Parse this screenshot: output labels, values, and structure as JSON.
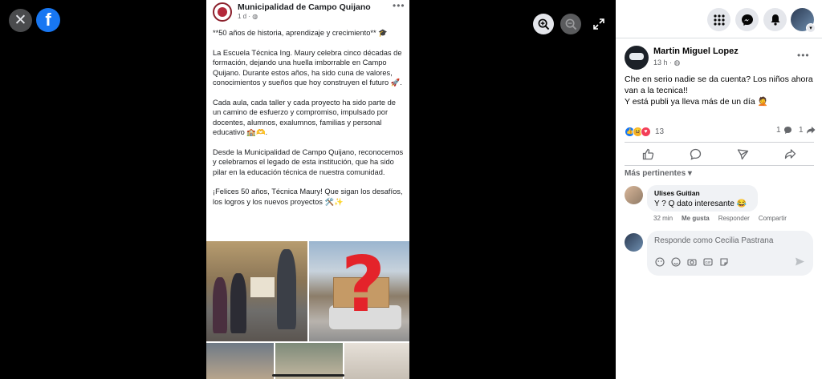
{
  "viewer": {
    "close_icon": "close-icon",
    "logo_icon": "facebook-logo-icon",
    "logo_text": "f",
    "zoom_in_icon": "zoom-in-icon",
    "zoom_out_icon": "zoom-out-icon",
    "expand_icon": "expand-icon"
  },
  "photo_post": {
    "page_name": "Municipalidad de Campo Quijano",
    "time": "1 d · ",
    "paragraphs": [
      "**50 años de historia, aprendizaje y crecimiento** 🎓",
      "La Escuela Técnica Ing. Maury celebra cinco décadas de formación, dejando una huella imborrable en Campo Quijano. Durante estos años, ha sido cuna de valores, conocimientos y sueños que hoy construyen el futuro 🚀.",
      "Cada aula, cada taller y cada proyecto ha sido parte de un camino de esfuerzo y compromiso, impulsado por docentes, alumnos, exalumnos, familias y personal educativo 🏫🫶.",
      "Desde la Municipalidad de Campo Quijano, reconocemos y celebramos el legado de esta institución, que ha sido pilar en la educación técnica de nuestra comunidad.",
      "¡Felices 50 años, Técnica Maury! Que sigan los desafíos, los logros y los nuevos proyectos 🛠️✨"
    ],
    "question_mark": "?"
  },
  "topbar": {
    "menu_icon": "grid-menu-icon",
    "messenger_icon": "messenger-icon",
    "notifications_icon": "bell-icon",
    "account_icon": "account-avatar",
    "badge_icon": "chevron-down-icon"
  },
  "post": {
    "author": "Martin Miguel Lopez",
    "time": "13 h · ",
    "text_lines": [
      "Che en serio nadie se da cuenta? Los niños ahora",
      "van a la tecnica!!",
      "Y está publi ya lleva más de un día 🤦"
    ],
    "reaction_count": "13",
    "comment_count": "1",
    "share_count": "1"
  },
  "comments": {
    "sort_label": "Más pertinentes ▾",
    "items": [
      {
        "author": "Ulises Guitian",
        "text": "Y ? Q dato interesante 😂",
        "time": "32 min",
        "like_label": "Me gusta",
        "reply_label": "Responder",
        "share_label": "Compartir"
      }
    ],
    "reply_placeholder": "Responde como Cecilia Pastrana"
  }
}
